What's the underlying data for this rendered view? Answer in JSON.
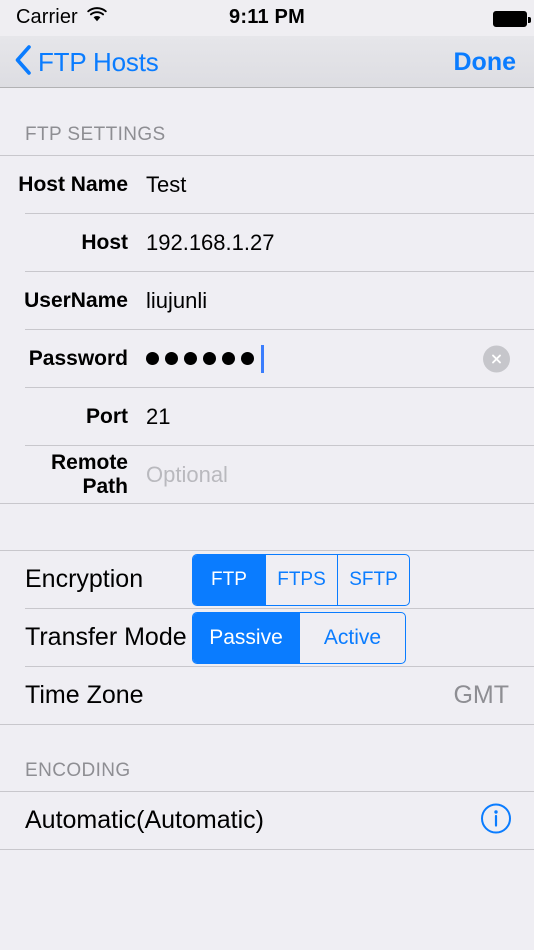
{
  "status_bar": {
    "carrier": "Carrier",
    "wifi_icon": "wifi-icon",
    "time": "9:11 PM",
    "battery_icon": "battery-full-icon"
  },
  "nav_bar": {
    "back_icon": "chevron-left-icon",
    "back_label": "FTP Hosts",
    "done_label": "Done"
  },
  "colors": {
    "accent": "#0a7cff",
    "background": "#efeef3",
    "separator": "#c8c7cc",
    "header_text": "#8e8e93",
    "placeholder": "#b9b9be"
  },
  "sections": {
    "ftp_settings": {
      "header": "FTP SETTINGS",
      "fields": [
        {
          "label": "Host Name",
          "value": "Test",
          "placeholder": ""
        },
        {
          "label": "Host",
          "value": "192.168.1.27",
          "placeholder": ""
        },
        {
          "label": "UserName",
          "value": "liujunli",
          "placeholder": ""
        },
        {
          "label": "Password",
          "value": "••••••",
          "placeholder": "",
          "secure": true,
          "dot_count": 6,
          "focused": true,
          "clear_icon": "clear-circle-icon"
        },
        {
          "label": "Port",
          "value": "21",
          "placeholder": ""
        },
        {
          "label": "Remote Path",
          "value": "",
          "placeholder": "Optional"
        }
      ]
    },
    "options": {
      "encryption": {
        "label": "Encryption",
        "options": [
          "FTP",
          "FTPS",
          "SFTP"
        ],
        "selected": "FTP"
      },
      "transfer_mode": {
        "label": "Transfer Mode",
        "options": [
          "Passive",
          "Active"
        ],
        "selected": "Passive"
      },
      "time_zone": {
        "label": "Time Zone",
        "value": "GMT"
      }
    },
    "encoding": {
      "header": "ENCODING",
      "row_label": "Automatic(Automatic)",
      "info_icon": "info-circle-icon"
    }
  }
}
